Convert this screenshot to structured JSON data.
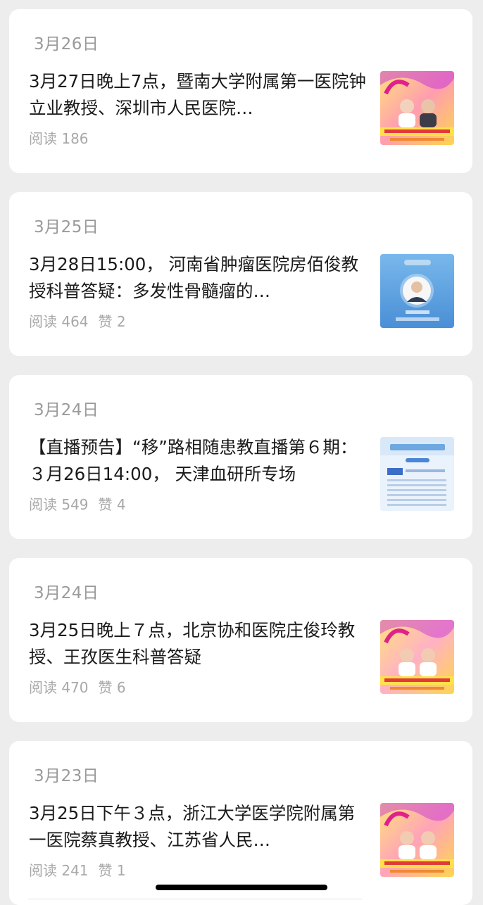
{
  "colors": {
    "background": "#ededed",
    "card": "#ffffff",
    "date_text": "#9a9a9a",
    "title_text": "#1a1a1a",
    "stats_text": "#a8a8a8"
  },
  "articles": [
    {
      "date": "3月26日",
      "title": "3月27日晚上7点，暨南大学附属第一医院钟立业教授、深圳市人民医院…",
      "reads": "阅读 186",
      "likes": "",
      "thumb_icon": "doctor-duo-poster-thumbnail"
    },
    {
      "date": "3月25日",
      "title": "3月28日15:00， 河南省肿瘤医院房佰俊教授科普答疑：多发性骨髓瘤的…",
      "reads": "阅读 464",
      "likes": "赞 2",
      "thumb_icon": "doctor-portrait-thumbnail"
    },
    {
      "date": "3月24日",
      "title": "【直播预告】“移”路相随患教直播第６期：３月26日14:00， 天津血研所专场",
      "reads": "阅读 549",
      "likes": "赞 4",
      "thumb_icon": "schedule-poster-thumbnail"
    },
    {
      "date": "3月24日",
      "title": "3月25日晚上７点，北京协和医院庄俊玲教授、王孜医生科普答疑",
      "reads": "阅读 470",
      "likes": "赞 6",
      "thumb_icon": "doctor-duo-poster-thumbnail"
    },
    {
      "date": "3月23日",
      "title": "3月25日下午３点，浙江大学医学院附属第一医院蔡真教授、江苏省人民…",
      "reads": "阅读 241",
      "likes": "赞 1",
      "thumb_icon": "doctor-duo-poster-thumbnail"
    }
  ]
}
